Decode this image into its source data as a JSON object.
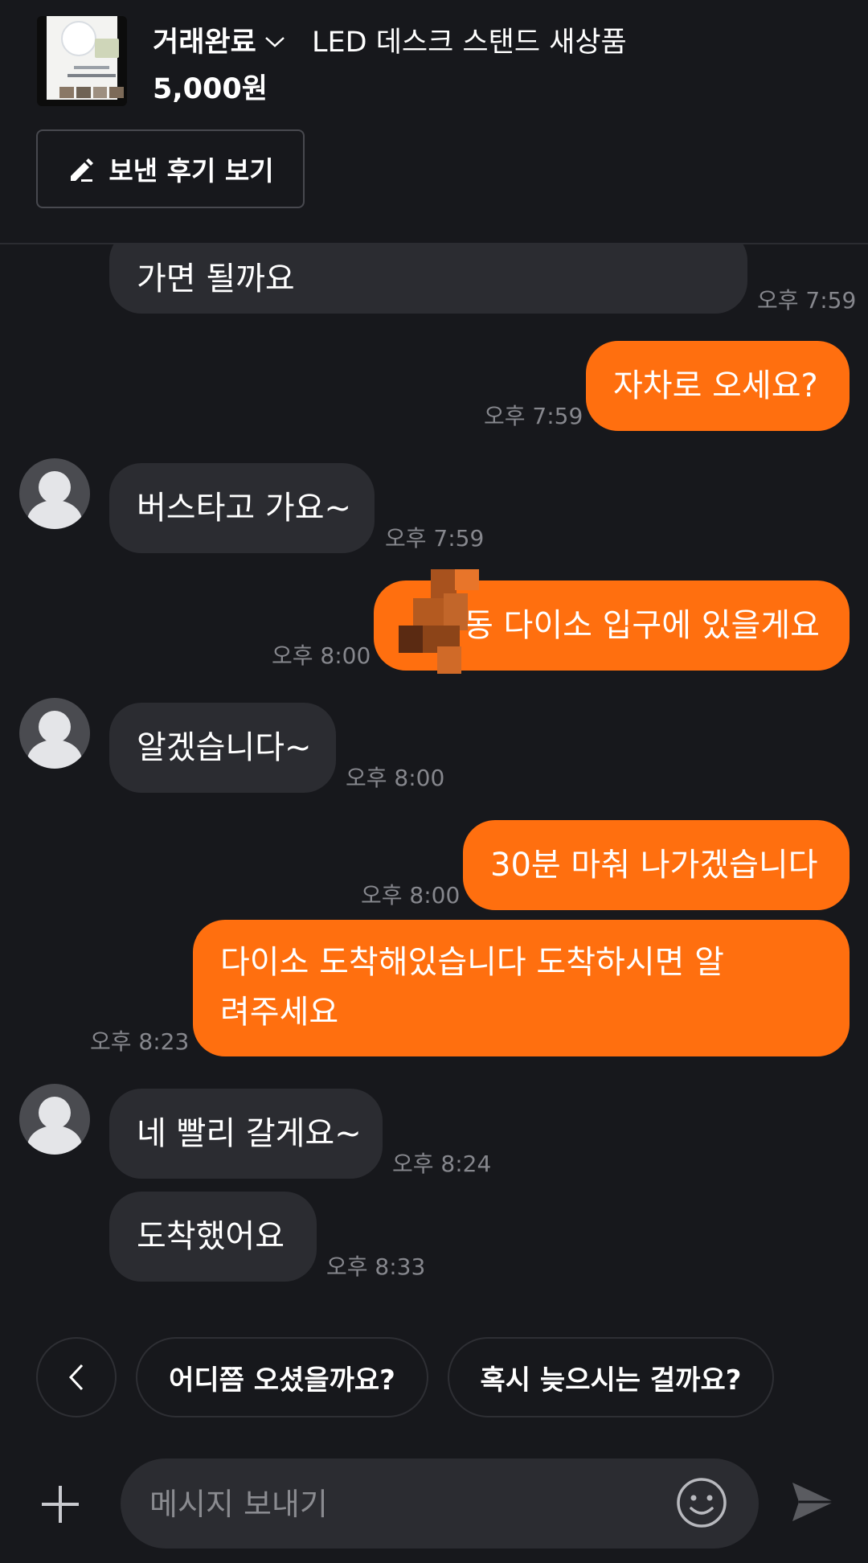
{
  "header": {
    "status": "거래완료",
    "product_title": "LED 데스크 스탠드 새상품",
    "price": "5,000원",
    "review_button": "보낸 후기 보기"
  },
  "messages": [
    {
      "from": "other",
      "text": "가면 될까요",
      "time": "오후 7:59"
    },
    {
      "from": "me",
      "text": "자차로 오세요?",
      "time": "오후 7:59"
    },
    {
      "from": "other",
      "text": "버스타고 가요~",
      "time": "오후 7:59"
    },
    {
      "from": "me",
      "text": "동 다이소 입구에 있을게요",
      "time": "오후 8:00"
    },
    {
      "from": "other",
      "text": "알겠습니다~",
      "time": "오후 8:00"
    },
    {
      "from": "me",
      "text": "30분 마춰 나가겠습니다",
      "time": "오후 8:00"
    },
    {
      "from": "me",
      "text": "다이소 도착해있습니다 도착하시면 알려주세요",
      "time": "오후 8:23"
    },
    {
      "from": "other",
      "text": "네 빨리 갈게요~",
      "time": "오후 8:24"
    },
    {
      "from": "other",
      "text": "도착했어요",
      "time": "오후 8:33"
    }
  ],
  "quick_replies": [
    "어디쯤 오셨을까요?",
    "혹시 늦으시는 걸까요?"
  ],
  "input": {
    "placeholder": "메시지 보내기"
  },
  "colors": {
    "background": "#17181c",
    "sent_bubble": "#ff6f0f",
    "received_bubble": "#2b2c31",
    "timestamp": "#86878d"
  },
  "icons": [
    "pencil-icon",
    "chevron-down-icon",
    "chevron-left-icon",
    "plus-icon",
    "emoji-icon",
    "send-icon",
    "default-avatar-icon"
  ]
}
